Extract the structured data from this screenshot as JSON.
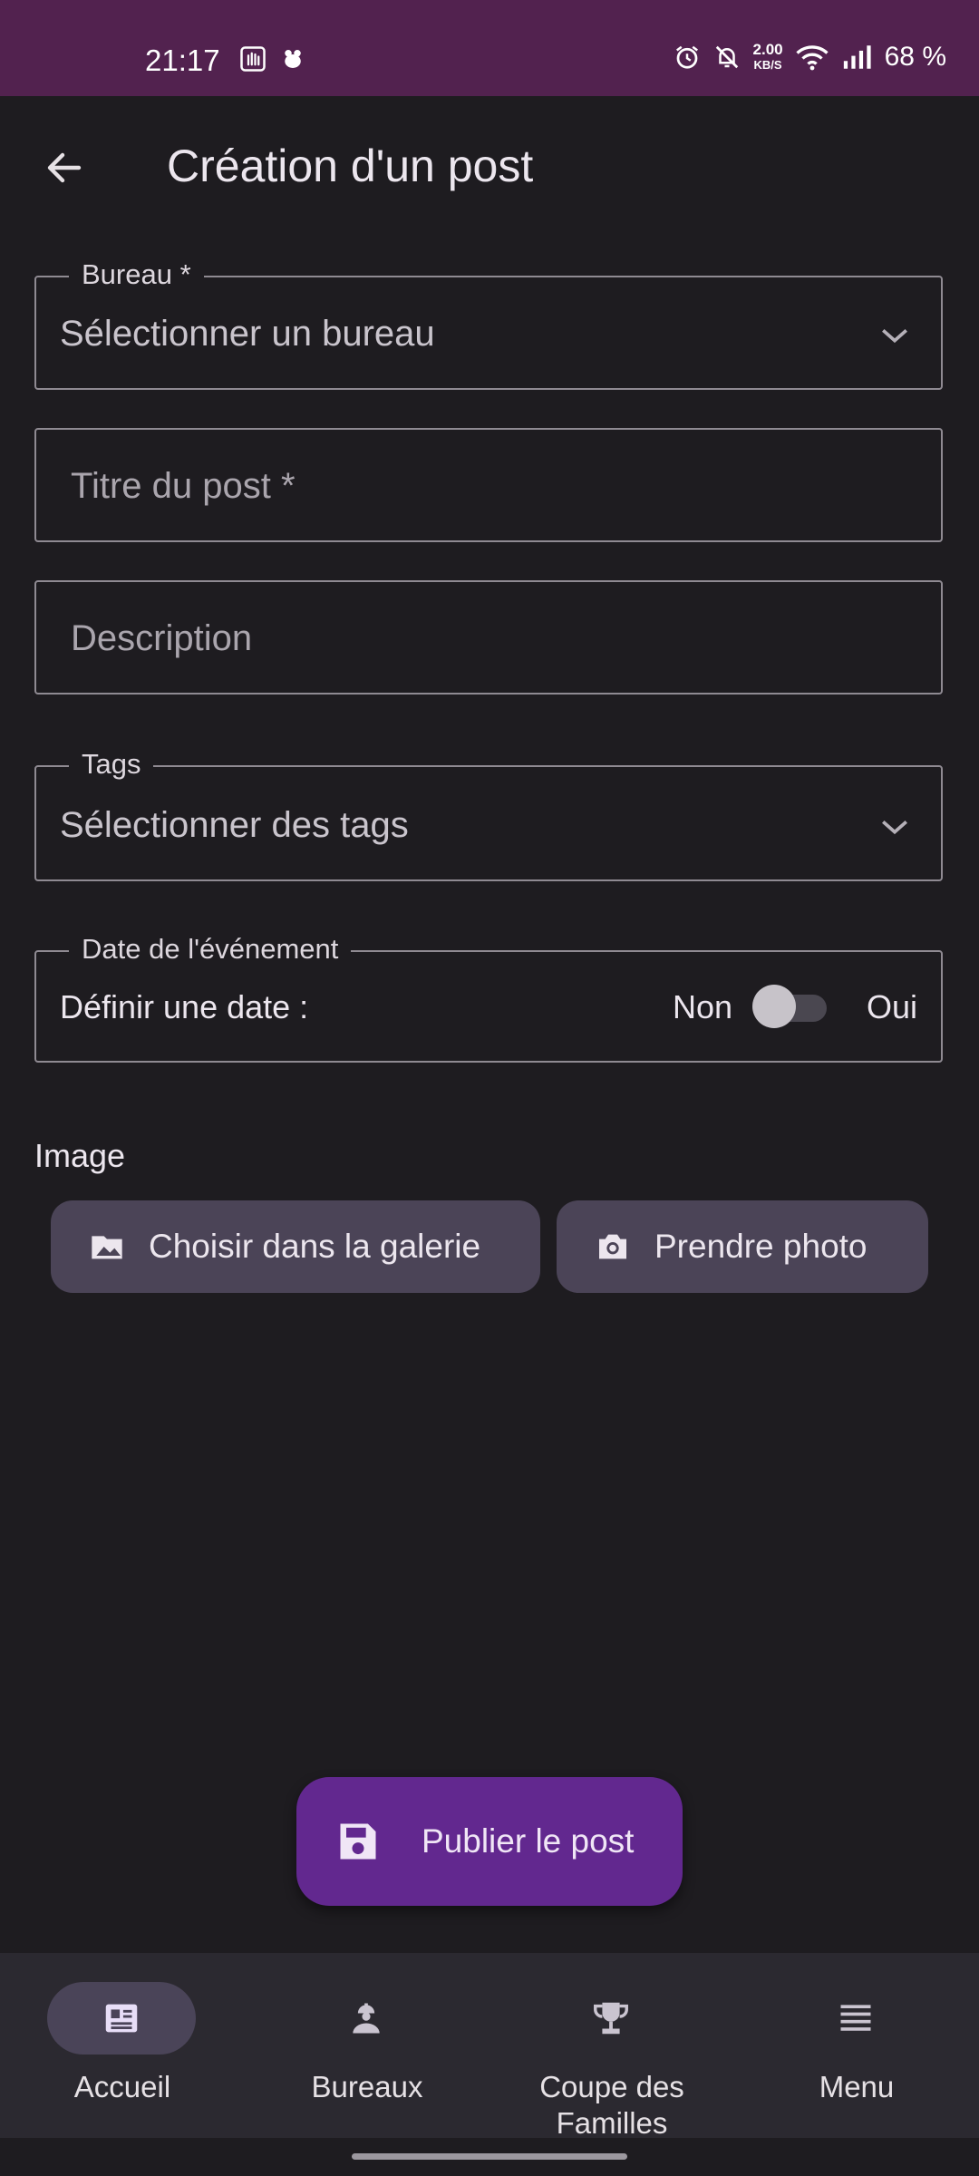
{
  "status_bar": {
    "time": "21:17",
    "speed_value": "2.00",
    "speed_unit": "KB/S",
    "battery": "68 %"
  },
  "header": {
    "title": "Création d'un post"
  },
  "form": {
    "bureau": {
      "label": "Bureau *",
      "value": "Sélectionner un bureau"
    },
    "title": {
      "placeholder": "Titre du post *"
    },
    "description": {
      "placeholder": "Description"
    },
    "tags": {
      "label": "Tags",
      "value": "Sélectionner des tags"
    },
    "event_date": {
      "label": "Date de l'événement",
      "prompt": "Définir une date :",
      "off_label": "Non",
      "on_label": "Oui",
      "enabled": false
    },
    "image": {
      "label": "Image",
      "gallery_button": "Choisir dans la galerie",
      "camera_button": "Prendre photo"
    }
  },
  "fab": {
    "label": "Publier le post"
  },
  "bottom_nav": {
    "items": [
      {
        "label": "Accueil",
        "icon": "newspaper-icon",
        "active": true
      },
      {
        "label": "Bureaux",
        "icon": "worker-icon",
        "active": false
      },
      {
        "label": "Coupe des Familles",
        "icon": "trophy-icon",
        "active": false
      },
      {
        "label": "Menu",
        "icon": "menu-icon",
        "active": false
      }
    ]
  },
  "colors": {
    "status_bar": "#52224f",
    "background": "#1e1c20",
    "fab": "#62288f",
    "tonal_button": "#4b4457",
    "nav_bar": "#2b2930"
  }
}
